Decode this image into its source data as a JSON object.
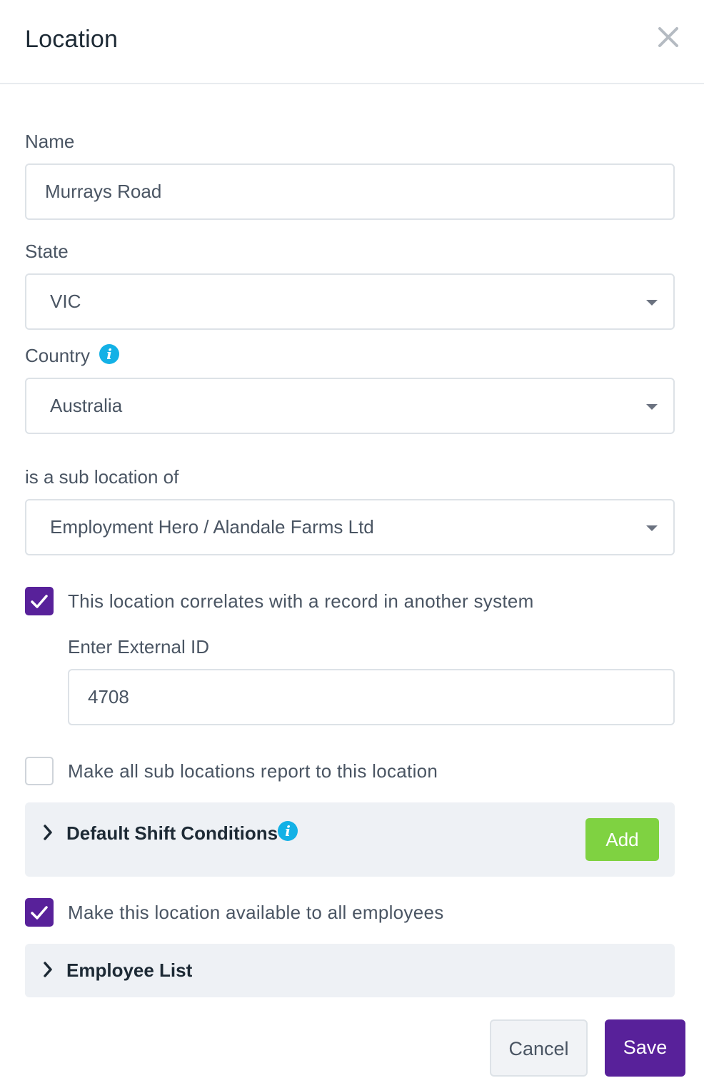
{
  "dialog": {
    "title": "Location",
    "close_icon": "close-icon"
  },
  "form": {
    "name_label": "Name",
    "name_value": "Murrays Road",
    "state_label": "State",
    "state_value": "VIC",
    "country_label": "Country",
    "country_value": "Australia",
    "parent_label": "is a sub location of",
    "parent_value": "Employment Hero / Alandale Farms Ltd",
    "external_checkbox": {
      "label": "This location correlates with a record in another system",
      "checked": true
    },
    "external_id_label": "Enter External ID",
    "external_id_value": "4708",
    "sub_report_checkbox": {
      "label": "Make all sub locations report to this location",
      "checked": false
    },
    "shift_conditions": {
      "title": "Default Shift Conditions",
      "add_label": "Add"
    },
    "available_checkbox": {
      "label": "Make this location available to all employees",
      "checked": true
    },
    "employee_list": {
      "title": "Employee List"
    }
  },
  "footer": {
    "cancel_label": "Cancel",
    "save_label": "Save"
  },
  "colors": {
    "primary": "#58219a",
    "add_green": "#7fd241",
    "info_blue": "#13b1e6"
  }
}
